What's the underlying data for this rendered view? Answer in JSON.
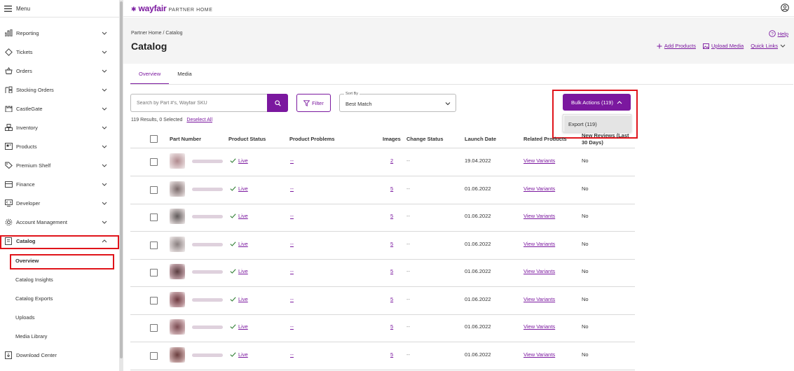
{
  "app": {
    "logo_mark": "✱",
    "logo_brand": "wayfair",
    "logo_suffix": "PARTNER HOME"
  },
  "sidebar": {
    "menu_label": "Menu",
    "items": [
      {
        "label": "Reporting",
        "icon": "bar-chart-icon"
      },
      {
        "label": "Tickets",
        "icon": "ticket-icon"
      },
      {
        "label": "Orders",
        "icon": "orders-icon"
      },
      {
        "label": "Stocking Orders",
        "icon": "stocking-icon"
      },
      {
        "label": "CastleGate",
        "icon": "castle-icon"
      },
      {
        "label": "Inventory",
        "icon": "inventory-icon"
      },
      {
        "label": "Products",
        "icon": "products-icon"
      },
      {
        "label": "Premium Shelf",
        "icon": "tag-icon"
      },
      {
        "label": "Finance",
        "icon": "finance-icon"
      },
      {
        "label": "Developer",
        "icon": "developer-icon"
      },
      {
        "label": "Account Management",
        "icon": "gear-icon"
      },
      {
        "label": "Catalog",
        "icon": "catalog-icon"
      }
    ],
    "catalog_sub": [
      {
        "label": "Overview"
      },
      {
        "label": "Catalog Insights"
      },
      {
        "label": "Catalog Exports"
      },
      {
        "label": "Uploads"
      },
      {
        "label": "Media Library"
      }
    ],
    "download_center": "Download Center"
  },
  "header": {
    "breadcrumb": "Partner Home / Catalog",
    "title": "Catalog",
    "help": "Help",
    "add_products": "Add Products",
    "upload_media": "Upload Media",
    "quick_links": "Quick Links"
  },
  "tabs": [
    {
      "label": "Overview"
    },
    {
      "label": "Media"
    }
  ],
  "toolbar": {
    "search_placeholder": "Search by Part #'s, Wayfair SKU",
    "filter_label": "Filter",
    "sort_label": "Sort By",
    "sort_value": "Best Match",
    "bulk_label": "Bulk Actions (119)",
    "bulk_menu_item": "Export (119)"
  },
  "results": {
    "summary": "119 Results, 0 Selected",
    "deselect": "Deselect All"
  },
  "table": {
    "headers": {
      "part_number": "Part Number",
      "product_status": "Product Status",
      "product_problems": "Product Problems",
      "images": "Images",
      "change_status": "Change Status",
      "launch_date": "Launch Date",
      "related_products": "Related Products",
      "new_reviews": "New Reviews (Last 30 Days)"
    },
    "rows": [
      {
        "status": "Live",
        "problems": "--",
        "images": "2",
        "change": "--",
        "launch": "19.04.2022",
        "related": "View Variants",
        "reviews": "No"
      },
      {
        "status": "Live",
        "problems": "--",
        "images": "5",
        "change": "--",
        "launch": "01.06.2022",
        "related": "View Variants",
        "reviews": "No"
      },
      {
        "status": "Live",
        "problems": "--",
        "images": "5",
        "change": "--",
        "launch": "01.06.2022",
        "related": "View Variants",
        "reviews": "No"
      },
      {
        "status": "Live",
        "problems": "--",
        "images": "5",
        "change": "--",
        "launch": "01.06.2022",
        "related": "View Variants",
        "reviews": "No"
      },
      {
        "status": "Live",
        "problems": "--",
        "images": "5",
        "change": "--",
        "launch": "01.06.2022",
        "related": "View Variants",
        "reviews": "No"
      },
      {
        "status": "Live",
        "problems": "--",
        "images": "5",
        "change": "--",
        "launch": "01.06.2022",
        "related": "View Variants",
        "reviews": "No"
      },
      {
        "status": "Live",
        "problems": "--",
        "images": "5",
        "change": "--",
        "launch": "01.06.2022",
        "related": "View Variants",
        "reviews": "No"
      },
      {
        "status": "Live",
        "problems": "--",
        "images": "5",
        "change": "--",
        "launch": "01.06.2022",
        "related": "View Variants",
        "reviews": "No"
      }
    ]
  },
  "colors": {
    "brand": "#7b189f",
    "highlight": "#e0141b",
    "live": "#2e7d32"
  }
}
